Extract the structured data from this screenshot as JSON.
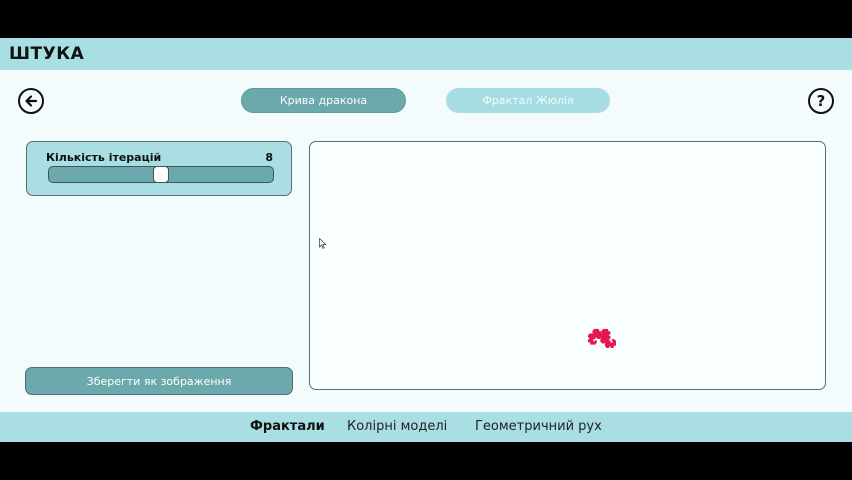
{
  "app": {
    "title": "ШТУКА"
  },
  "header": {
    "back_icon": "arrow-left-circle-icon",
    "help_label": "?",
    "tabs": [
      {
        "label": "Крива дракона",
        "active": true
      },
      {
        "label": "Фрактал Жюлія",
        "active": false
      }
    ]
  },
  "iterations": {
    "label": "Кількість ітерацій",
    "value": "8",
    "fraction": 0.5
  },
  "actions": {
    "save_label": "Зберегти як зображення"
  },
  "fractal": {
    "color": "#e8164f",
    "iterations": 8
  },
  "bottom_nav": [
    {
      "label": "Фрактали",
      "active": true
    },
    {
      "label": "Колірні моделі",
      "active": false
    },
    {
      "label": "Геометричний рух",
      "active": false
    }
  ],
  "colors": {
    "accent": "#a9dfe3",
    "button": "#6ba9ad",
    "fractal": "#e8164f"
  }
}
